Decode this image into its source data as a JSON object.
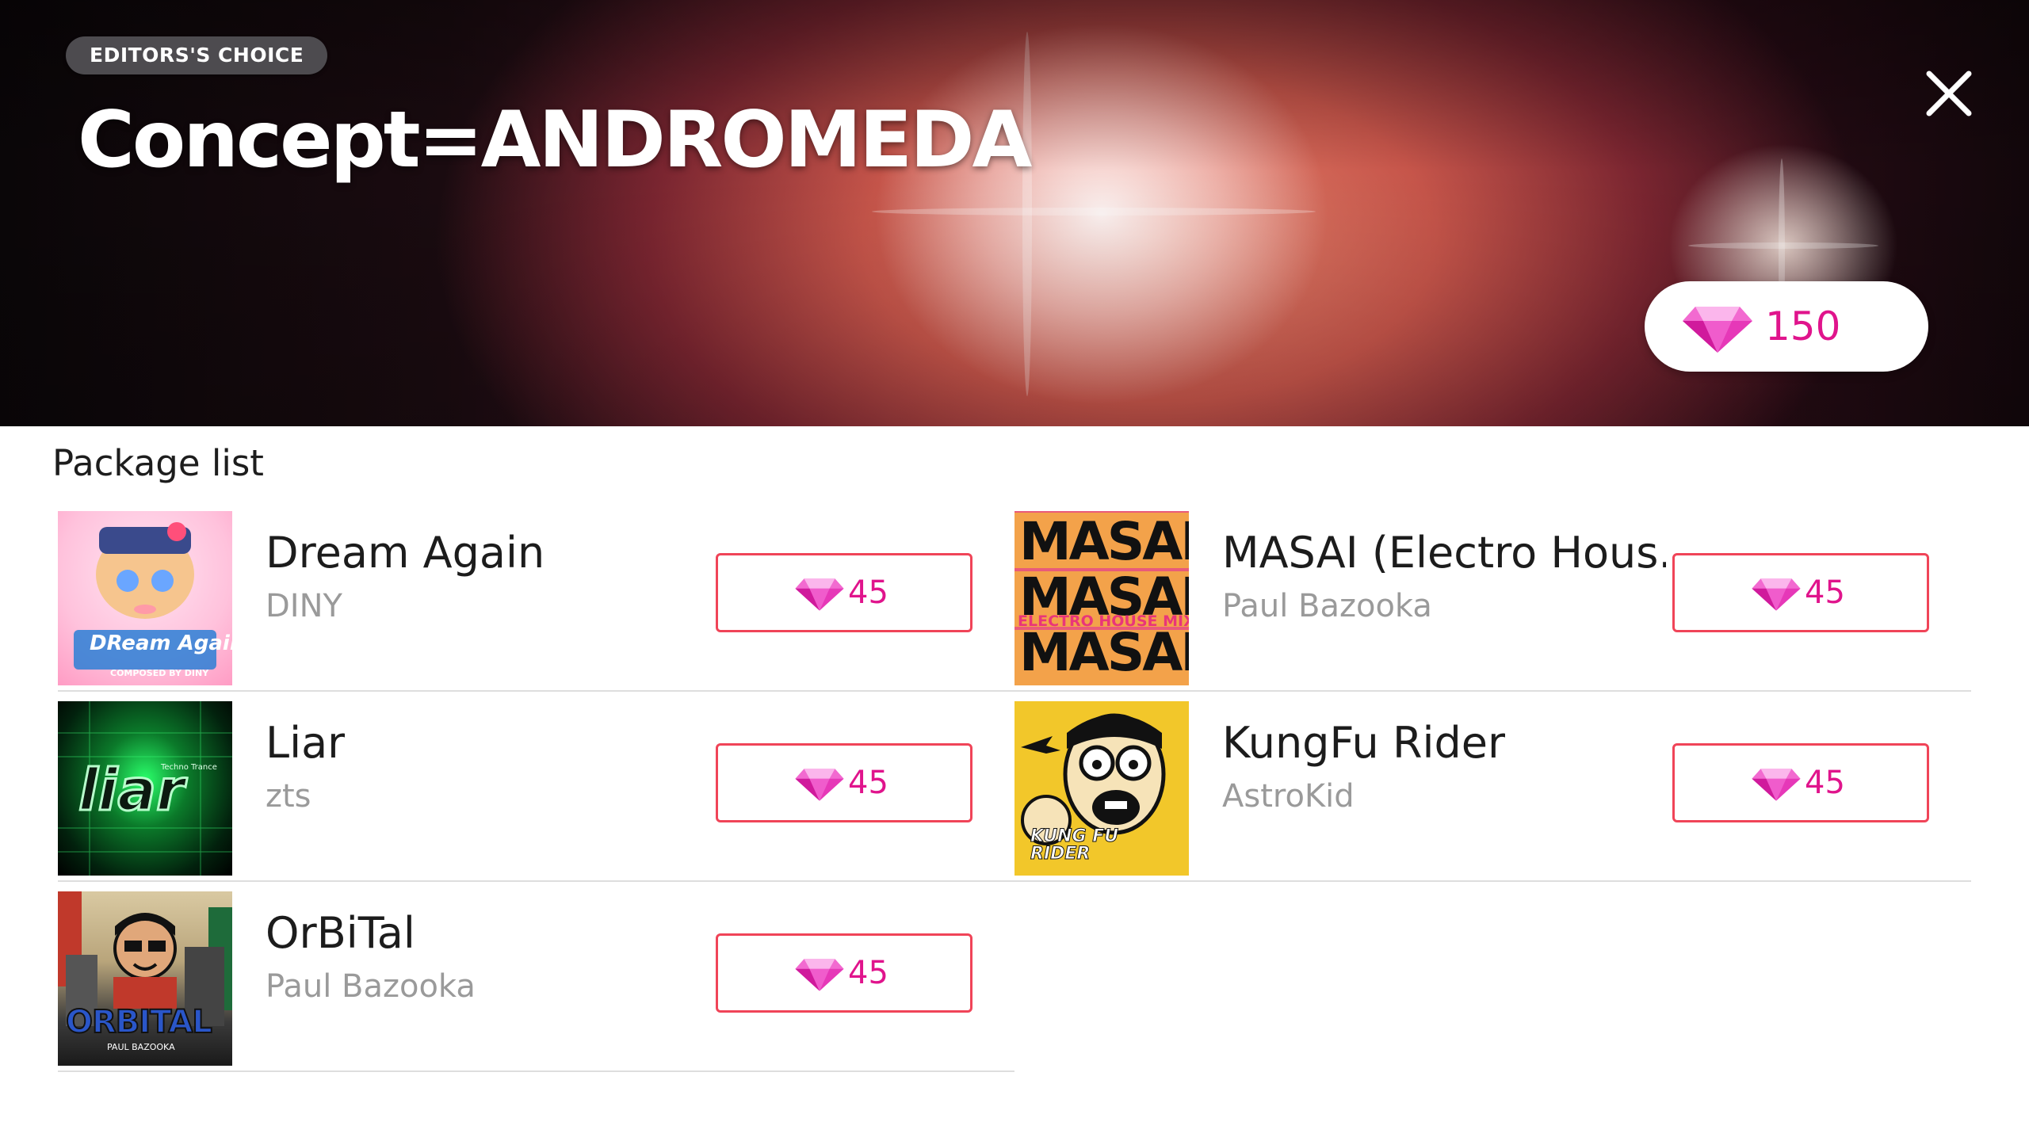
{
  "header": {
    "badge": "EDITORS'S CHOICE",
    "title": "Concept=ANDROMEDA",
    "price": "150",
    "close_icon": "close-icon"
  },
  "section_title": "Package list",
  "packages": [
    {
      "title": "Dream Again",
      "artist": "DINY",
      "price": "45",
      "art_text": "DReam Again",
      "art_caption": "COMPOSED BY DINY"
    },
    {
      "title": "MASAI (Electro Hous...",
      "artist": "Paul Bazooka",
      "price": "45",
      "art_text": "MASAI",
      "art_caption": "ELECTRO HOUSE MIX"
    },
    {
      "title": "Liar",
      "artist": "zts",
      "price": "45",
      "art_text": "liar",
      "art_caption": "Techno Trance"
    },
    {
      "title": "KungFu Rider",
      "artist": "AstroKid",
      "price": "45",
      "art_text": "KUNG FU RIDER",
      "art_caption": ""
    },
    {
      "title": "OrBiTal",
      "artist": "Paul Bazooka",
      "price": "45",
      "art_text": "ORBITAL",
      "art_caption": "PAUL BAZOOKA"
    }
  ],
  "colors": {
    "accent": "#e0148c",
    "button_border": "#f04458",
    "artist_text": "#9a9a9a"
  }
}
